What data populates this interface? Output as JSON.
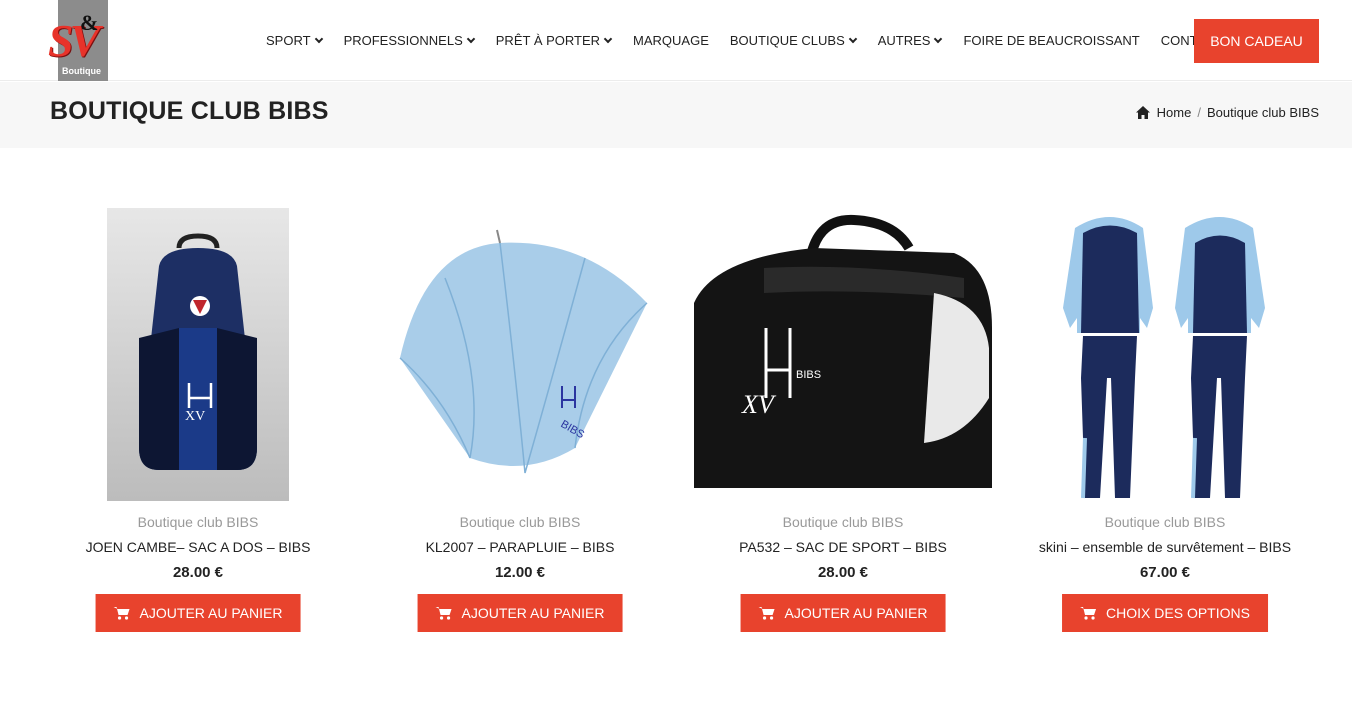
{
  "header": {
    "logo": {
      "letters": "SV",
      "amp": "&",
      "tagline": "Boutique"
    },
    "nav": [
      {
        "label": "SPORT",
        "has_dropdown": true
      },
      {
        "label": "PROFESSIONNELS",
        "has_dropdown": true
      },
      {
        "label": "PRÊT À PORTER",
        "has_dropdown": true
      },
      {
        "label": "MARQUAGE",
        "has_dropdown": false
      },
      {
        "label": "BOUTIQUE CLUBS",
        "has_dropdown": true
      },
      {
        "label": "AUTRES",
        "has_dropdown": true
      },
      {
        "label": "FOIRE DE BEAUCROISSANT",
        "has_dropdown": false
      },
      {
        "label": "CONTACT",
        "has_dropdown": false
      }
    ],
    "cta_label": "BON CADEAU"
  },
  "page": {
    "title": "BOUTIQUE CLUB BIBS",
    "breadcrumb": {
      "home": "Home",
      "separator": "/",
      "current": "Boutique club BIBS"
    }
  },
  "products": [
    {
      "category": "Boutique club BIBS",
      "name": "JOEN CAMBE– SAC A DOS – BIBS",
      "price": "28.00 €",
      "button": "AJOUTER AU PANIER",
      "image": "backpack-image"
    },
    {
      "category": "Boutique club BIBS",
      "name": "KL2007 – PARAPLUIE – BIBS",
      "price": "12.00 €",
      "button": "AJOUTER AU PANIER",
      "image": "umbrella-image"
    },
    {
      "category": "Boutique club BIBS",
      "name": "PA532 – SAC DE SPORT – BIBS",
      "price": "28.00 €",
      "button": "AJOUTER AU PANIER",
      "image": "sports-bag-image"
    },
    {
      "category": "Boutique club BIBS",
      "name": "skini – ensemble de survêtement – BIBS",
      "price": "67.00 €",
      "button": "CHOIX DES OPTIONS",
      "image": "tracksuit-image"
    }
  ],
  "colors": {
    "accent": "#e8432d",
    "band": "#f7f7f7",
    "muted_text": "#999999"
  }
}
